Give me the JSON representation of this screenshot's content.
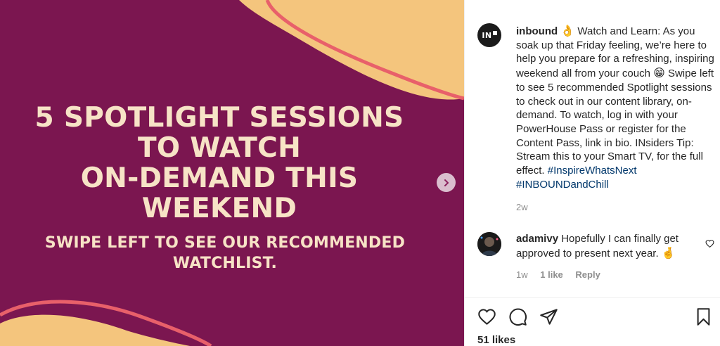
{
  "post": {
    "headline": [
      "5 SPOTLIGHT SESSIONS",
      "TO WATCH",
      "ON-DEMAND THIS",
      "WEEKEND"
    ],
    "subline": [
      "SWIPE LEFT TO SEE OUR RECOMMENDED",
      "WATCHLIST."
    ],
    "colors": {
      "background": "#7b1650",
      "shape": "#f4c57d",
      "line": "#e8606a",
      "text": "#f7e3c6"
    }
  },
  "account": {
    "avatar_text": "IN",
    "username": "inbound",
    "caption_emoji_1": "👌",
    "caption_part_1": "Watch and Learn: As you soak up that Friday feeling, we’re here to help you prepare for a refreshing, inspiring weekend all from your couch",
    "caption_emoji_2": "😁",
    "caption_part_2": "Swipe left to see 5 recommended Spotlight sessions to check out in our content library, on-demand. To watch, log in with your PowerHouse Pass or register for the Content Pass, link in bio. INsiders Tip: Stream this to your Smart TV, for the full effect.",
    "hashtag_1": "#InspireWhatsNext",
    "hashtag_2": "#INBOUNDandChill",
    "time": "2w"
  },
  "comment": {
    "username": "adamivy",
    "text": "Hopefully I can finally get approved to present next year.",
    "emoji": "🤞",
    "time": "1w",
    "likes": "1 like",
    "reply": "Reply"
  },
  "likes": "51 likes",
  "icons": [
    "chevron-right-icon",
    "heart-icon",
    "comment-icon",
    "share-icon",
    "bookmark-icon"
  ]
}
